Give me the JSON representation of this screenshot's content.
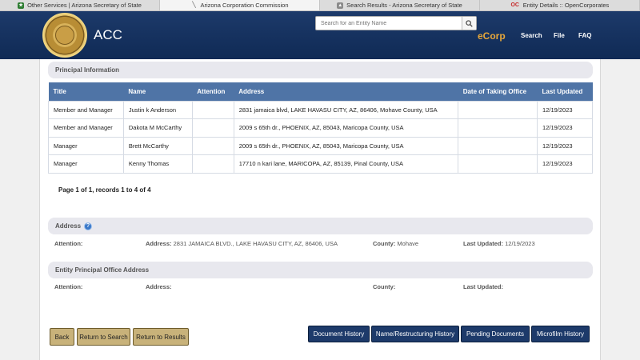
{
  "browser_tabs": [
    {
      "label": "Other Services | Arizona Secretary of State",
      "icon": "az-flag-icon"
    },
    {
      "label": "Arizona Corporation Commission",
      "icon": "acc-icon"
    },
    {
      "label": "Search Results - Arizona Secretary of State",
      "icon": "search-results-icon"
    },
    {
      "label": "Entity Details :: OpenCorporates",
      "icon": "opencorporates-icon"
    }
  ],
  "header": {
    "title": "ACC",
    "search_placeholder": "Search for an Entity Name",
    "ecorp_label": "eCorp",
    "nav": [
      "Search",
      "File",
      "FAQ"
    ],
    "colors": {
      "bar": "#1d3a6a",
      "ecorp": "#e7a73a"
    }
  },
  "principal": {
    "section_title": "Principal Information",
    "columns": [
      "Title",
      "Name",
      "Attention",
      "Address",
      "Date of Taking Office",
      "Last Updated"
    ],
    "rows": [
      {
        "title": "Member and Manager",
        "name": "Justin k Anderson",
        "attention": "",
        "address": "2831 jamaica blvd, LAKE HAVASU CITY, AZ, 86406, Mohave County, USA",
        "date_office": "",
        "last_updated": "12/19/2023"
      },
      {
        "title": "Member and Manager",
        "name": "Dakota M McCarthy",
        "attention": "",
        "address": "2009 s 65th dr., PHOENIX, AZ, 85043, Maricopa County, USA",
        "date_office": "",
        "last_updated": "12/19/2023"
      },
      {
        "title": "Manager",
        "name": "Brett McCarthy",
        "attention": "",
        "address": "2009 s 65th dr., PHOENIX, AZ, 85043, Maricopa County, USA",
        "date_office": "",
        "last_updated": "12/19/2023"
      },
      {
        "title": "Manager",
        "name": "Kenny Thomas",
        "attention": "",
        "address": "17710 n kari lane, MARICOPA, AZ, 85139, Pinal County, USA",
        "date_office": "",
        "last_updated": "12/19/2023"
      }
    ],
    "pager": "Page 1 of 1, records 1 to 4 of 4"
  },
  "address": {
    "section_title": "Address",
    "attention_label": "Attention:",
    "attention_value": "",
    "address_label": "Address:",
    "address_value": "2831 JAMAICA BLVD., LAKE HAVASU CITY, AZ, 86406, USA",
    "county_label": "County:",
    "county_value": "Mohave",
    "updated_label": "Last Updated:",
    "updated_value": "12/19/2023"
  },
  "principal_office": {
    "section_title": "Entity Principal Office Address",
    "attention_label": "Attention:",
    "address_label": "Address:",
    "county_label": "County:",
    "updated_label": "Last Updated:"
  },
  "buttons": {
    "back": "Back",
    "return_search": "Return to Search",
    "return_results": "Return to Results",
    "document_history": "Document History",
    "name_history": "Name/Restructuring History",
    "pending_documents": "Pending Documents",
    "microfilm_history": "Microfilm History"
  }
}
